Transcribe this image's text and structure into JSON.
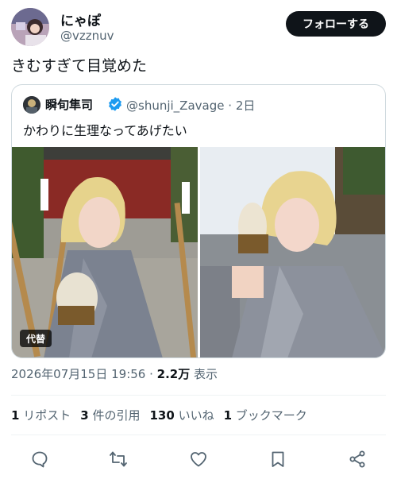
{
  "author": {
    "display_name": "にゃぽ",
    "handle": "@vzznuv",
    "follow_label": "フォローする"
  },
  "tweet": {
    "text": "きむすぎて目覚めた"
  },
  "quote": {
    "display_name": "瞬旬隼司",
    "handle": "@shunji_Zavage",
    "separator": "·",
    "age": "2日",
    "text": "かわりに生理なってあげたい",
    "alt_badge": "代替"
  },
  "timestamp": {
    "datetime": "2026年07月15日 19:56 · ",
    "views_count": "2.2万",
    "views_label": " 表示"
  },
  "stats": {
    "reposts_count": "1",
    "reposts_label": "リポスト",
    "quotes_count": "3",
    "quotes_label": "件の引用",
    "likes_count": "130",
    "likes_label": "いいね",
    "bookmarks_count": "1",
    "bookmarks_label": "ブックマーク"
  },
  "colors": {
    "text_primary": "#0f1419",
    "text_secondary": "#536471",
    "border": "#cfd9de",
    "verified_blue": "#1d9bf0",
    "follow_bg": "#0f1419"
  },
  "icons": [
    "reply-icon",
    "repost-icon",
    "like-icon",
    "bookmark-icon",
    "share-icon",
    "verified-badge-icon"
  ]
}
